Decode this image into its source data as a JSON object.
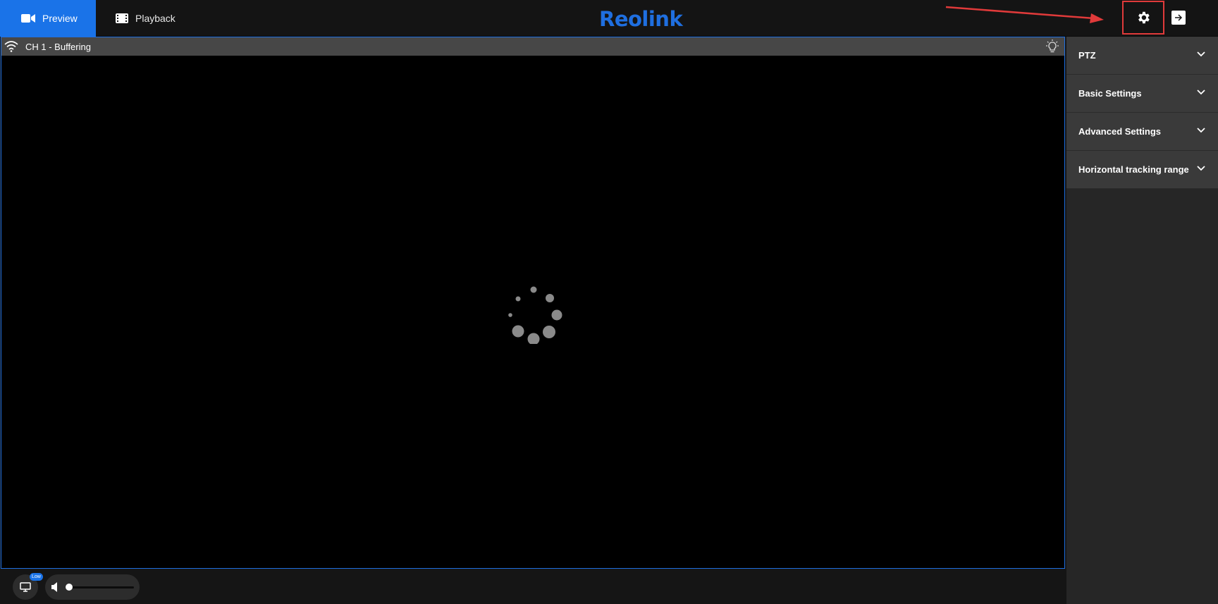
{
  "topbar": {
    "tabs": [
      {
        "label": "Preview",
        "active": true,
        "icon": "video-camera-icon"
      },
      {
        "label": "Playback",
        "active": false,
        "icon": "film-icon"
      }
    ],
    "logo": "Reolink",
    "settings_icon": "gear-icon",
    "logout_icon": "logout-icon"
  },
  "video": {
    "channel_title": "CH 1 - Buffering",
    "status_icon": "wifi-icon",
    "light_icon": "light-bulb-icon",
    "loading_icon": "spinner-icon"
  },
  "bottombar": {
    "stream_badge": "Low",
    "stream_icon": "monitor-icon",
    "volume_icon": "speaker-icon",
    "volume_level": 0
  },
  "sidebar": {
    "sections": [
      {
        "label": "PTZ"
      },
      {
        "label": "Basic Settings"
      },
      {
        "label": "Advanced Settings"
      },
      {
        "label": "Horizontal tracking range"
      }
    ]
  },
  "colors": {
    "accent": "#1a73e8",
    "annotation": "#e03a3a",
    "sidebar_item": "#3a3a3a"
  }
}
